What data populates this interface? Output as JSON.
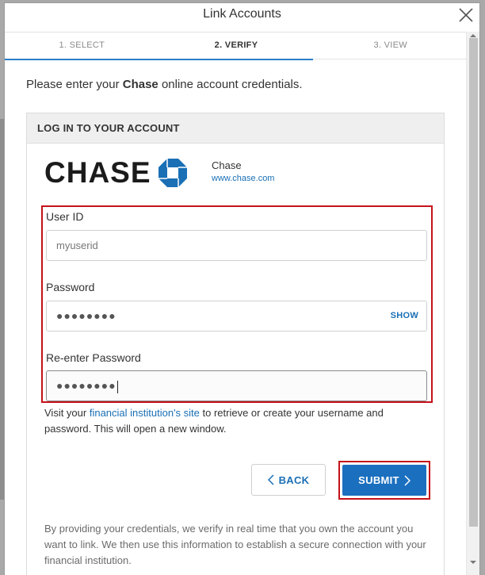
{
  "dialog": {
    "title": "Link Accounts"
  },
  "tabs": [
    {
      "label": "1. SELECT"
    },
    {
      "label": "2. VERIFY"
    },
    {
      "label": "3. VIEW"
    }
  ],
  "instructions": {
    "prefix": "Please enter your ",
    "bank": "Chase",
    "suffix": " online account credentials."
  },
  "card": {
    "header": "LOG IN TO YOUR ACCOUNT"
  },
  "bank": {
    "logo_text": "CHASE",
    "name": "Chase",
    "url": "www.chase.com",
    "logo_color": "#1a6fb5"
  },
  "form": {
    "user_id_label": "User ID",
    "user_id_value": "myuserid",
    "password_label": "Password",
    "password_value": "●●●●●●●●",
    "show_label": "SHOW",
    "reenter_label": "Re-enter Password",
    "reenter_value": "●●●●●●●●"
  },
  "help": {
    "prefix": "Visit your ",
    "link": "financial institution's site",
    "suffix": " to retrieve or create your username and password. This will open a new window."
  },
  "buttons": {
    "back_label": "BACK",
    "submit_label": "SUBMIT"
  },
  "disclaimer": "By providing your credentials, we verify in real time that you own the account you want to link. We then use this information to establish a secure connection with your financial institution.",
  "colors": {
    "accent": "#1a6fbf",
    "highlight": "#c4121a"
  }
}
